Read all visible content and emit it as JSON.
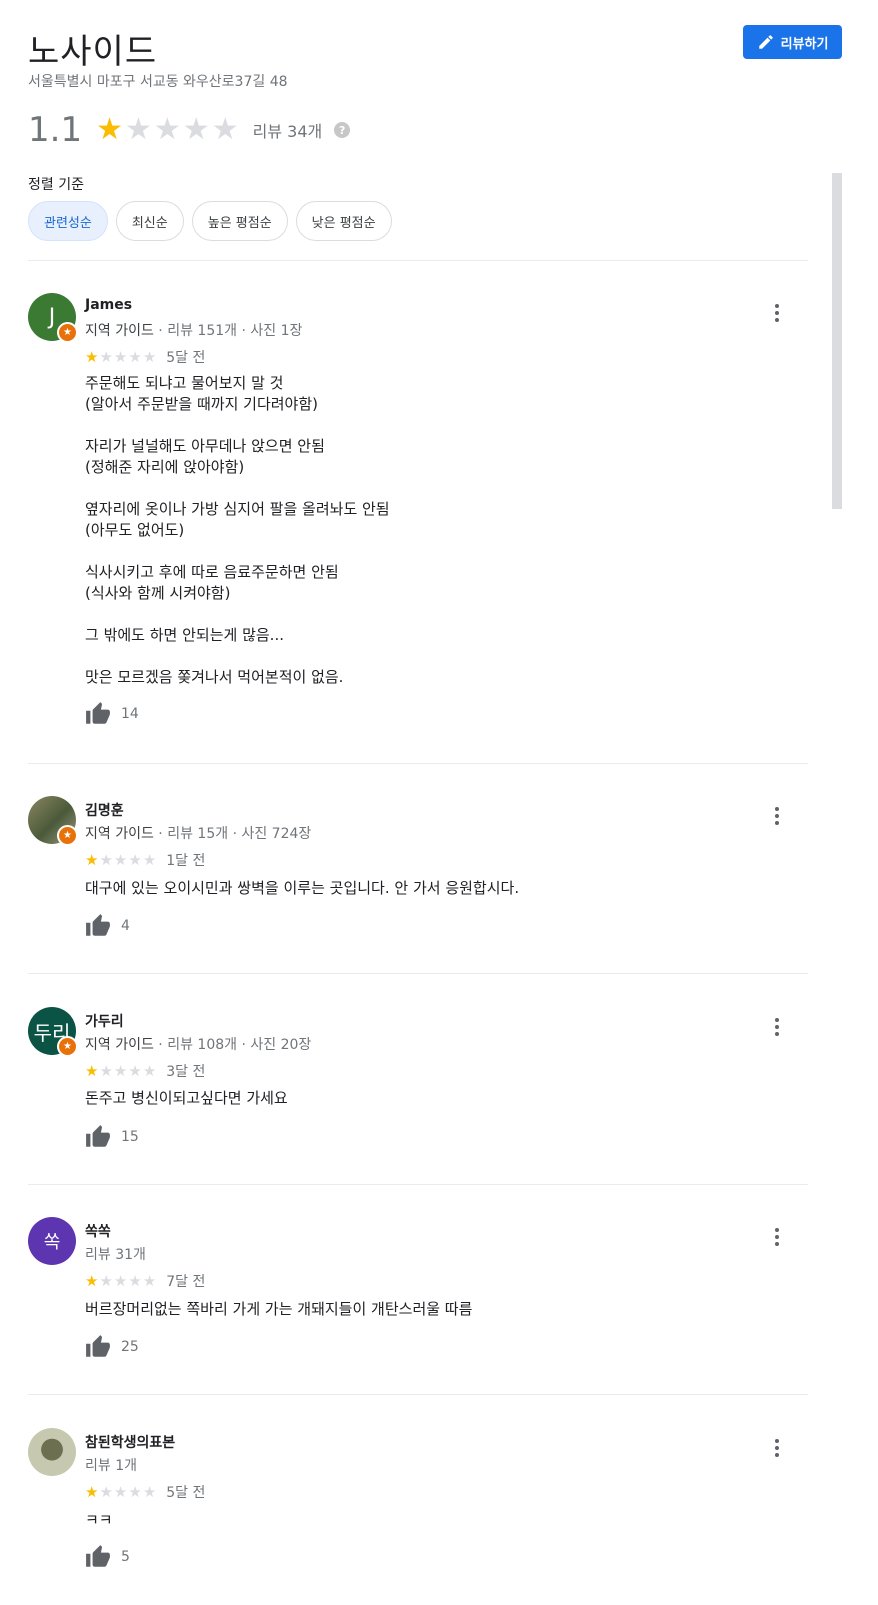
{
  "place": {
    "name": "노사이드",
    "address": "서울특별시 마포구 서교동 와우산로37길 48",
    "rating": "1.1",
    "rating_stars": 1,
    "review_count": "리뷰 34개",
    "write_review_label": "리뷰하기"
  },
  "sort": {
    "label": "정렬 기준",
    "options": [
      "관련성순",
      "최신순",
      "높은 평점순",
      "낮은 평점순"
    ],
    "selected": "관련성순"
  },
  "colors": {
    "accent": "#1a73e8",
    "star_on": "#fbbc04",
    "star_off": "#dadce0",
    "local_guide_badge": "#e8710a"
  },
  "reviews": [
    {
      "author": "James",
      "avatar_text": "J",
      "avatar_color": "#3a7a33",
      "local_guide": true,
      "guide_label": "지역 가이드",
      "stats": " · 리뷰 151개 · 사진 1장",
      "stars": 1,
      "date": "5달 전",
      "text": "주문해도 되냐고 물어보지 말 것\n(알아서 주문받을 때까지 기다려야함)\n\n자리가 널널해도 아무데나 앉으면 안됨\n(정해준 자리에 앉아야함)\n\n옆자리에 옷이나 가방 심지어 팔을 올려놔도 안됨\n(아무도 없어도)\n\n식사시키고 후에 따로 음료주문하면 안됨\n(식사와 함께 시켜야함)\n\n그 밖에도 하면 안되는게 많음...\n\n맛은 모르겠음 쫒겨나서 먹어본적이 없음.",
      "likes": "14"
    },
    {
      "author": "김명훈",
      "avatar_text": "",
      "avatar_color": "#6b6a4a",
      "local_guide": true,
      "guide_label": "지역 가이드",
      "stats": " · 리뷰 15개 · 사진 724장",
      "stars": 1,
      "date": "1달 전",
      "text": "대구에 있는 오이시민과 쌍벽을 이루는 곳입니다. 안 가서 응원합시다.",
      "likes": "4"
    },
    {
      "author": "가두리",
      "avatar_text": "두리",
      "avatar_color": "#0b5345",
      "local_guide": true,
      "guide_label": "지역 가이드",
      "stats": " · 리뷰 108개 · 사진 20장",
      "stars": 1,
      "date": "3달 전",
      "text": "돈주고 병신이되고싶다면 가세요",
      "likes": "15"
    },
    {
      "author": "쏙쏙",
      "avatar_text": "쏙",
      "avatar_color": "#5e35b1",
      "local_guide": false,
      "guide_label": "",
      "stats": "리뷰 31개",
      "stars": 1,
      "date": "7달 전",
      "text": "버르장머리없는 쪽바리 가게 가는 개돼지들이 개탄스러울 따름",
      "likes": "25"
    },
    {
      "author": "참된학생의표본",
      "avatar_text": "",
      "avatar_color": "#9aa07a",
      "local_guide": false,
      "guide_label": "",
      "stats": "리뷰 1개",
      "stars": 1,
      "date": "5달 전",
      "text": "ㅋㅋ",
      "likes": "5"
    }
  ]
}
